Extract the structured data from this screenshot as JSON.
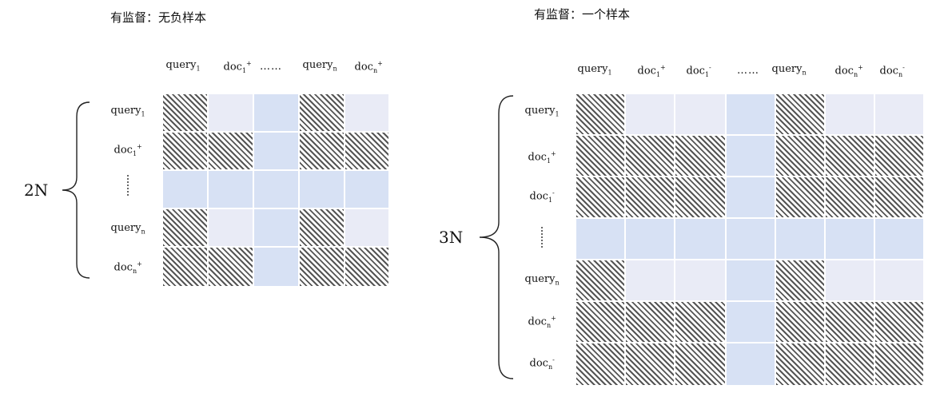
{
  "left": {
    "title": "有监督：无负样本",
    "count_label": "2N",
    "columns": [
      {
        "base": "query",
        "sub": "1",
        "sup": ""
      },
      {
        "base": "doc",
        "sub": "1",
        "sup": "+"
      },
      {
        "dots": "……"
      },
      {
        "base": "query",
        "sub": "n",
        "sup": ""
      },
      {
        "base": "doc",
        "sub": "n",
        "sup": "+"
      }
    ],
    "rows": [
      {
        "base": "query",
        "sub": "1",
        "sup": ""
      },
      {
        "base": "doc",
        "sub": "1",
        "sup": "+"
      },
      {
        "dots": "vertical"
      },
      {
        "base": "query",
        "sub": "n",
        "sup": ""
      },
      {
        "base": "doc",
        "sub": "n",
        "sup": "+"
      }
    ],
    "matrix": [
      [
        "H",
        "L",
        "B",
        "H",
        "L"
      ],
      [
        "H",
        "H",
        "B",
        "H",
        "H"
      ],
      [
        "B",
        "B",
        "B",
        "B",
        "B"
      ],
      [
        "H",
        "L",
        "B",
        "H",
        "L"
      ],
      [
        "H",
        "H",
        "B",
        "H",
        "H"
      ]
    ]
  },
  "right": {
    "title": "有监督：一个样本",
    "count_label": "3N",
    "columns": [
      {
        "base": "query",
        "sub": "1",
        "sup": ""
      },
      {
        "base": "doc",
        "sub": "1",
        "sup": "+"
      },
      {
        "base": "doc",
        "sub": "1",
        "sup": "-"
      },
      {
        "dots": "……"
      },
      {
        "base": "query",
        "sub": "n",
        "sup": ""
      },
      {
        "base": "doc",
        "sub": "n",
        "sup": "+"
      },
      {
        "base": "doc",
        "sub": "n",
        "sup": "-"
      }
    ],
    "rows": [
      {
        "base": "query",
        "sub": "1",
        "sup": ""
      },
      {
        "base": "doc",
        "sub": "1",
        "sup": "+"
      },
      {
        "base": "doc",
        "sub": "1",
        "sup": "-"
      },
      {
        "dots": "vertical"
      },
      {
        "base": "query",
        "sub": "n",
        "sup": ""
      },
      {
        "base": "doc",
        "sub": "n",
        "sup": "+"
      },
      {
        "base": "doc",
        "sub": "n",
        "sup": "-"
      }
    ],
    "matrix": [
      [
        "H",
        "L",
        "L",
        "B",
        "H",
        "L",
        "L"
      ],
      [
        "H",
        "H",
        "H",
        "B",
        "H",
        "H",
        "H"
      ],
      [
        "H",
        "H",
        "H",
        "B",
        "H",
        "H",
        "H"
      ],
      [
        "B",
        "B",
        "B",
        "B",
        "B",
        "B",
        "B"
      ],
      [
        "H",
        "L",
        "L",
        "B",
        "H",
        "L",
        "L"
      ],
      [
        "H",
        "H",
        "H",
        "B",
        "H",
        "H",
        "H"
      ],
      [
        "H",
        "H",
        "H",
        "B",
        "H",
        "H",
        "H"
      ]
    ]
  }
}
